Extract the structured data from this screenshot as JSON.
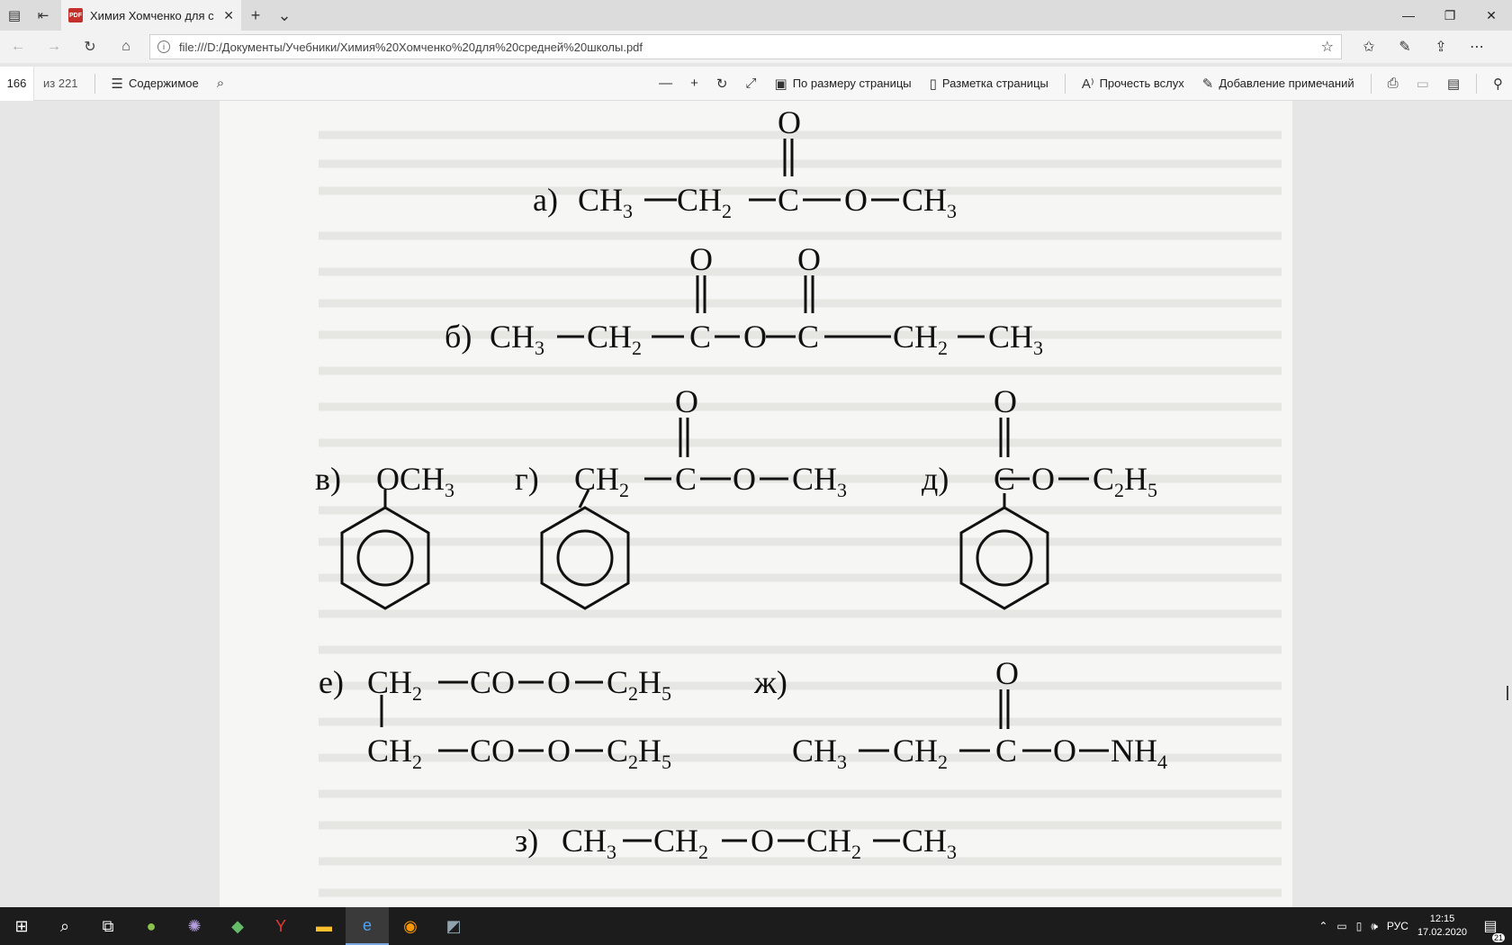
{
  "browser": {
    "tab_title": "Химия Хомченко для с",
    "url": "file:///D:/Документы/Учебники/Химия%20Хомченко%20для%20средней%20школы.pdf",
    "pdf_badge": "PDF"
  },
  "pdf_toolbar": {
    "page_number": "166",
    "page_total": "из 221",
    "contents_label": "Содержимое",
    "fit_page_label": "По размеру страницы",
    "layout_label": "Разметка страницы",
    "read_aloud_label": "Прочесть вслух",
    "add_notes_label": "Добавление примечаний"
  },
  "formulas": {
    "a": {
      "label": "а)",
      "chain": [
        "CH₃",
        "CH₂",
        "C",
        "O",
        "CH₃"
      ],
      "oxygen": "O"
    },
    "b": {
      "label": "б)",
      "chain": [
        "CH₃",
        "CH₂",
        "C",
        "O",
        "C",
        "CH₂",
        "CH₃"
      ],
      "oxygen": "O"
    },
    "v": {
      "label": "в)",
      "group": "OCH₃"
    },
    "g": {
      "label": "г)",
      "chain": [
        "CH₂",
        "C",
        "O",
        "CH₃"
      ],
      "oxygen": "O"
    },
    "d": {
      "label": "д)",
      "chain": [
        "C",
        "O",
        "C₂H₅"
      ],
      "oxygen": "O"
    },
    "e": {
      "label": "е)",
      "top": [
        "CH₂",
        "CO",
        "O",
        "C₂H₅"
      ],
      "bottom": [
        "CH₂",
        "CO",
        "O",
        "C₂H₅"
      ]
    },
    "zh": {
      "label": "ж)",
      "chain": [
        "CH₃",
        "CH₂",
        "C",
        "O",
        "NH₄"
      ],
      "oxygen": "O"
    },
    "z": {
      "label": "з)",
      "chain": [
        "CH₃",
        "CH₂",
        "O",
        "CH₂",
        "CH₃"
      ]
    }
  },
  "taskbar": {
    "language": "РУС",
    "time": "12:15",
    "date": "17.02.2020",
    "notifications": "21"
  }
}
